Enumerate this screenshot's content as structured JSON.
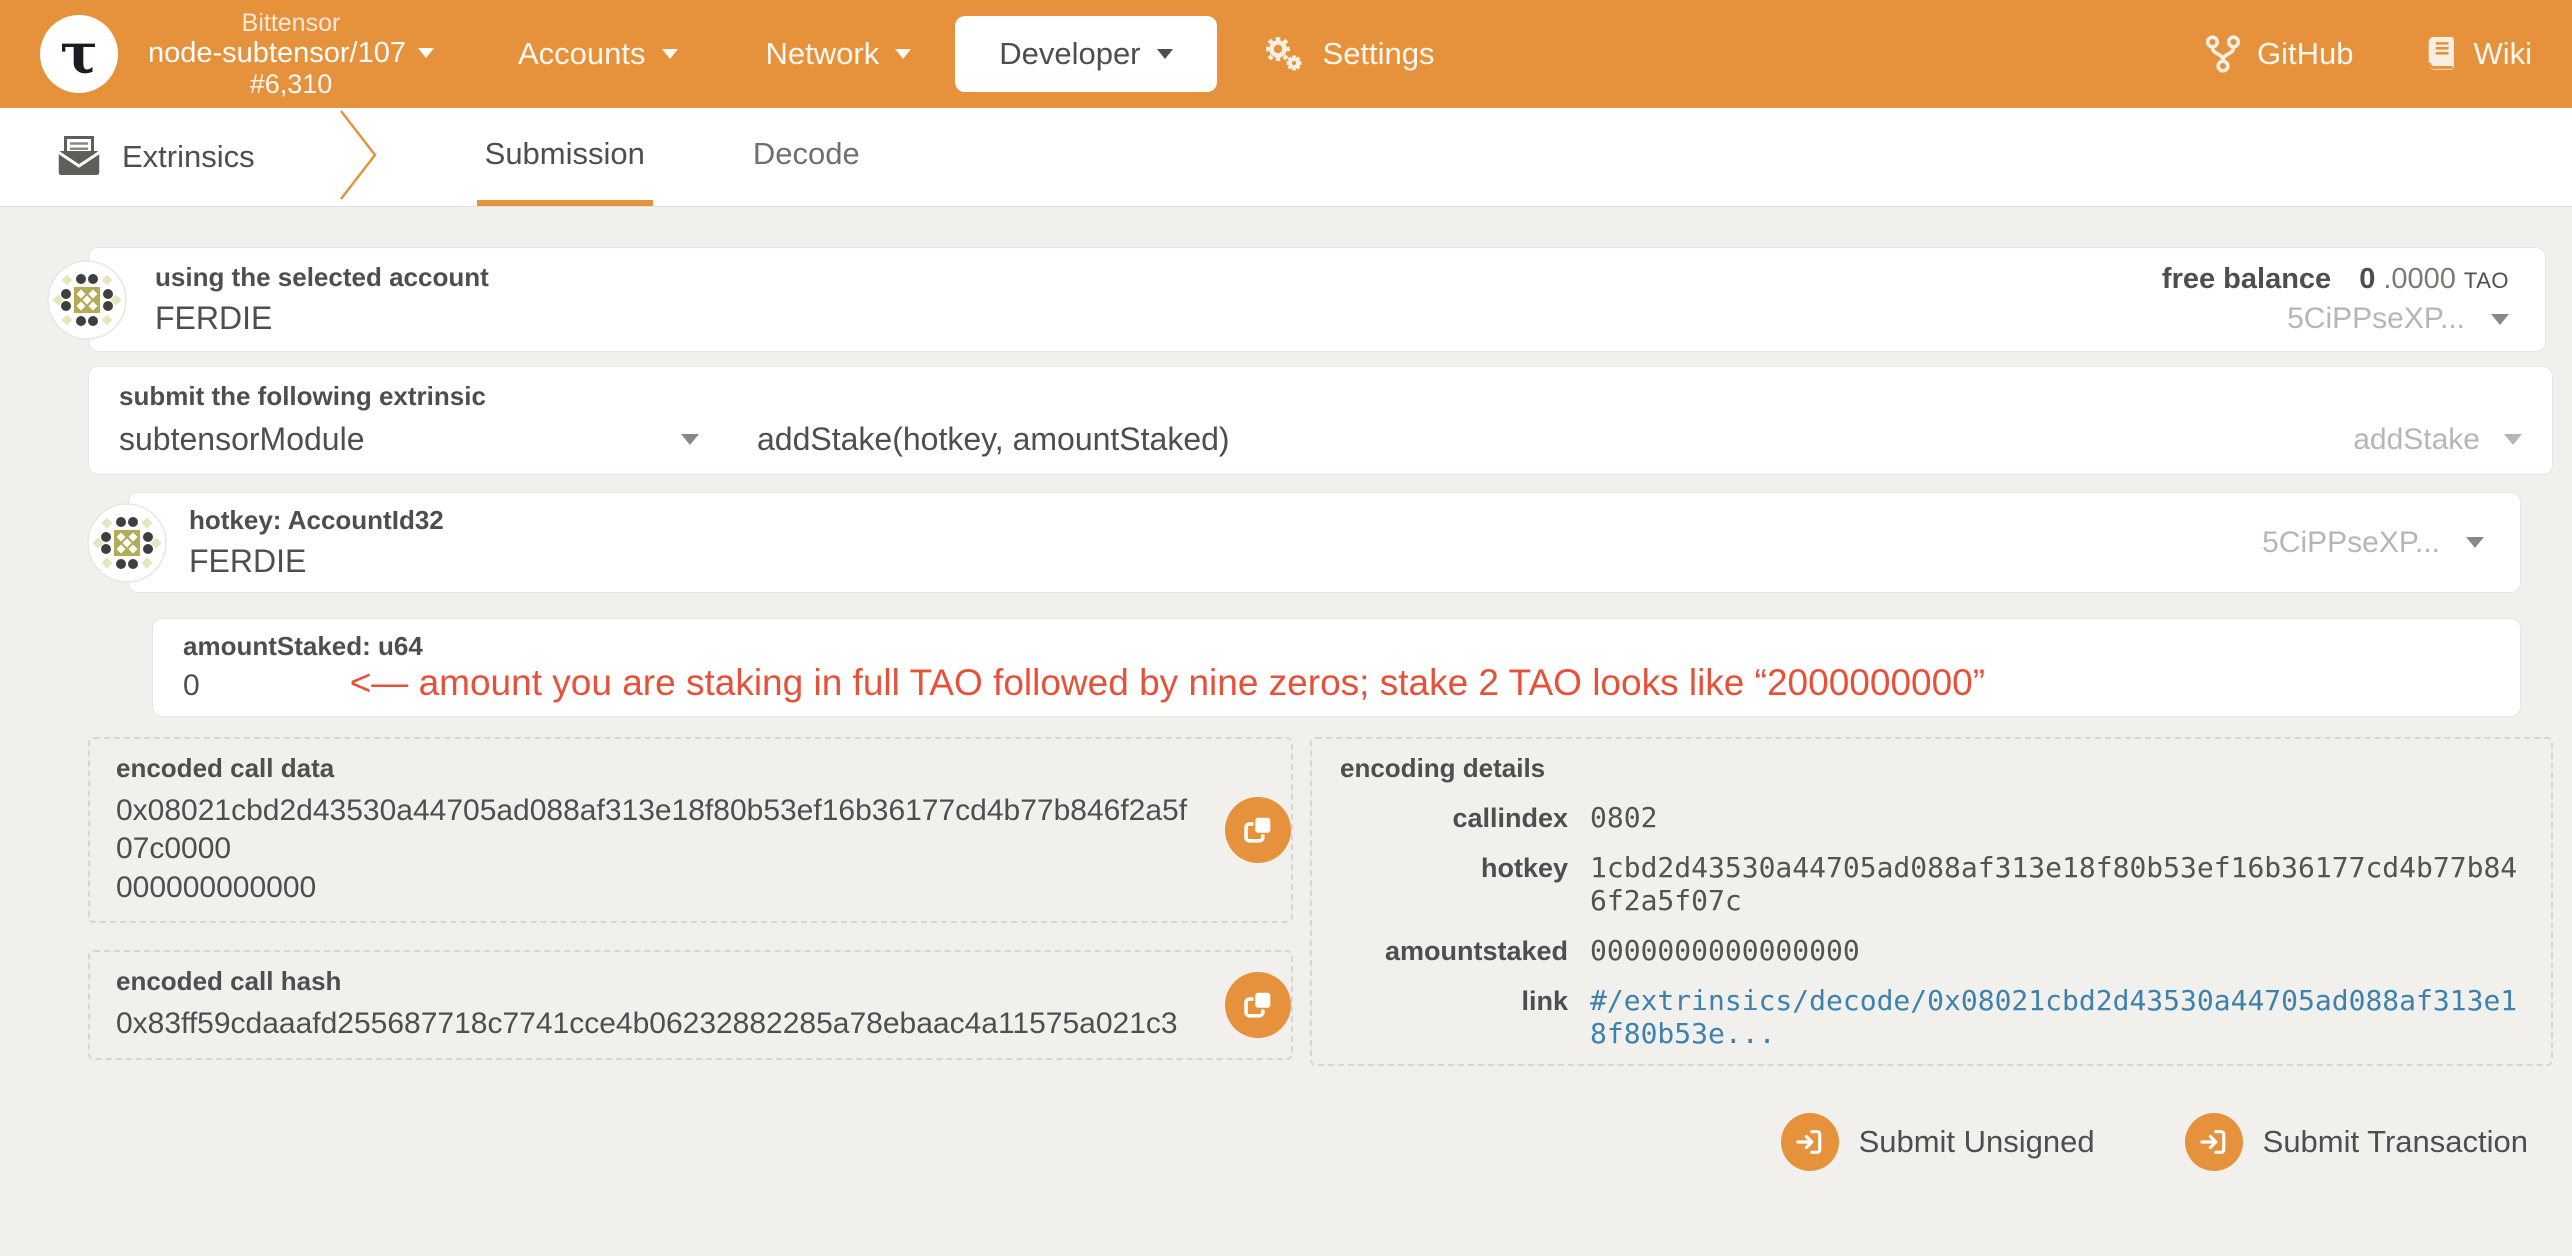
{
  "navbar": {
    "logo_letter": "τ",
    "chain": {
      "name": "Bittensor",
      "node": "node-subtensor/107",
      "block": "#6,310"
    },
    "menus": [
      {
        "label": "Accounts"
      },
      {
        "label": "Network"
      },
      {
        "label": "Developer"
      },
      {
        "label": "Settings"
      }
    ],
    "links": [
      {
        "label": "GitHub"
      },
      {
        "label": "Wiki"
      }
    ]
  },
  "tabbar": {
    "section": "Extrinsics",
    "tabs": [
      {
        "label": "Submission"
      },
      {
        "label": "Decode"
      }
    ]
  },
  "account": {
    "label": "using the selected account",
    "name": "FERDIE",
    "balance_label": "free balance",
    "balance_int": "0",
    "balance_frac": ".0000",
    "balance_unit": "TAO",
    "address_short": "5CiPPseXP..."
  },
  "extrinsic": {
    "label": "submit the following extrinsic",
    "module": "subtensorModule",
    "method_signature": "addStake(hotkey, amountStaked)",
    "method": "addStake"
  },
  "params": {
    "hotkey": {
      "label": "hotkey: AccountId32",
      "value": "FERDIE",
      "address_short": "5CiPPseXP..."
    },
    "amount": {
      "label": "amountStaked: u64",
      "value": "0",
      "annotation": "<— amount you are staking in full TAO followed by nine zeros; stake 2 TAO looks like “2000000000”"
    }
  },
  "outputs": {
    "call_data": {
      "label": "encoded call data",
      "value_line1": "0x08021cbd2d43530a44705ad088af313e18f80b53ef16b36177cd4b77b846f2a5f07c0000",
      "value_line2": "000000000000"
    },
    "call_hash": {
      "label": "encoded call hash",
      "value": "0x83ff59cdaaafd255687718c7741cce4b06232882285a78ebaac4a11575a021c3"
    }
  },
  "encoding_details": {
    "title": "encoding details",
    "rows": [
      {
        "label": "callindex",
        "value": "0802"
      },
      {
        "label": "hotkey",
        "value": "1cbd2d43530a44705ad088af313e18f80b53ef16b36177cd4b77b846f2a5f07c"
      },
      {
        "label": "amountstaked",
        "value": "0000000000000000"
      },
      {
        "label": "link",
        "value": "#/extrinsics/decode/0x08021cbd2d43530a44705ad088af313e18f80b53e..."
      }
    ]
  },
  "actions": {
    "submit_unsigned": "Submit Unsigned",
    "submit_transaction": "Submit Transaction"
  },
  "colors": {
    "accent": "#e6913c",
    "red": "#e65139",
    "link": "#3d82ad"
  }
}
